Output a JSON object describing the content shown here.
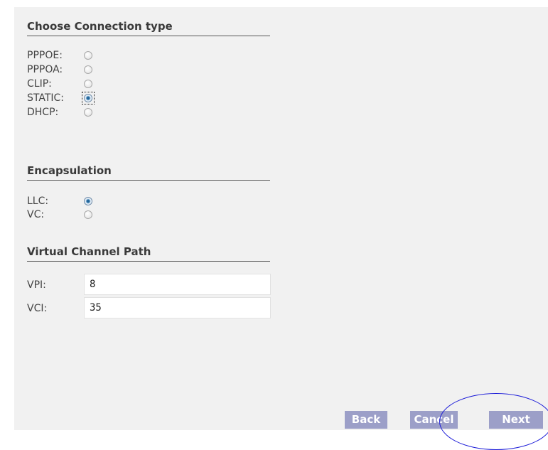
{
  "connection_type": {
    "title": "Choose Connection type",
    "options": [
      {
        "label": "PPPOE:",
        "selected": false
      },
      {
        "label": "PPPOA:",
        "selected": false
      },
      {
        "label": "CLIP:",
        "selected": false
      },
      {
        "label": "STATIC:",
        "selected": true
      },
      {
        "label": "DHCP:",
        "selected": false
      }
    ]
  },
  "encapsulation": {
    "title": "Encapsulation",
    "options": [
      {
        "label": "LLC:",
        "selected": true
      },
      {
        "label": "VC:",
        "selected": false
      }
    ]
  },
  "virtual_channel": {
    "title": "Virtual Channel Path",
    "vpi": {
      "label": "VPI:",
      "value": "8"
    },
    "vci": {
      "label": "VCI:",
      "value": "35"
    }
  },
  "buttons": {
    "back": "Back",
    "cancel": "Cancel",
    "next": "Next"
  }
}
